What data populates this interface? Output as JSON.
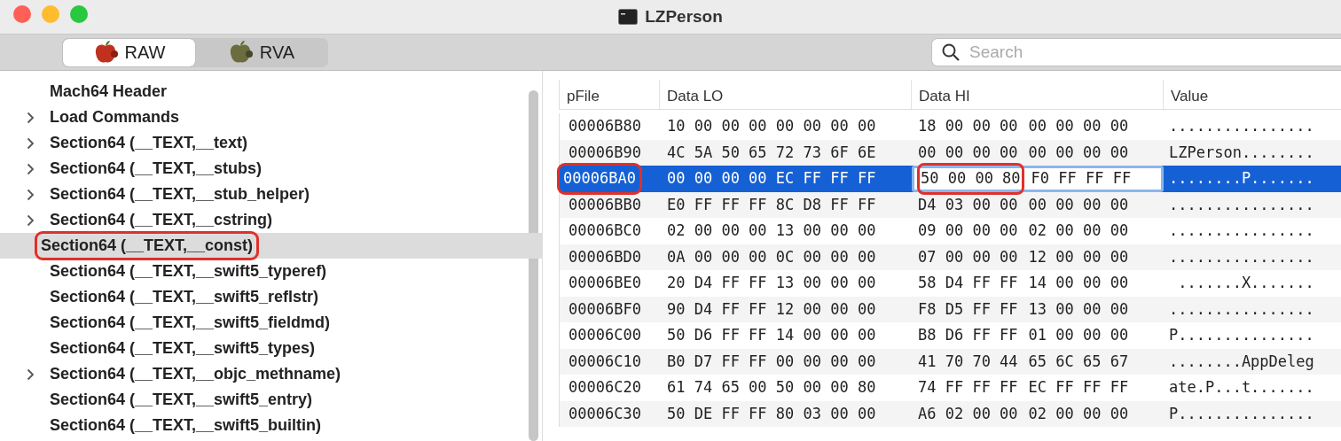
{
  "window": {
    "title": "LZPerson"
  },
  "modes": [
    {
      "label": "RAW",
      "selected": true,
      "kind": "raw"
    },
    {
      "label": "RVA",
      "selected": false,
      "kind": "rva"
    }
  ],
  "search": {
    "placeholder": "Search"
  },
  "tree": [
    {
      "label": "Mach64 Header",
      "expandable": false,
      "selected": false,
      "circled": false
    },
    {
      "label": "Load Commands",
      "expandable": true,
      "selected": false,
      "circled": false
    },
    {
      "label": "Section64 (__TEXT,__text)",
      "expandable": true,
      "selected": false,
      "circled": false
    },
    {
      "label": "Section64 (__TEXT,__stubs)",
      "expandable": true,
      "selected": false,
      "circled": false
    },
    {
      "label": "Section64 (__TEXT,__stub_helper)",
      "expandable": true,
      "selected": false,
      "circled": false
    },
    {
      "label": "Section64 (__TEXT,__cstring)",
      "expandable": true,
      "selected": false,
      "circled": false
    },
    {
      "label": "Section64 (__TEXT,__const)",
      "expandable": false,
      "selected": true,
      "circled": true
    },
    {
      "label": "Section64 (__TEXT,__swift5_typeref)",
      "expandable": false,
      "selected": false,
      "circled": false
    },
    {
      "label": "Section64 (__TEXT,__swift5_reflstr)",
      "expandable": false,
      "selected": false,
      "circled": false
    },
    {
      "label": "Section64 (__TEXT,__swift5_fieldmd)",
      "expandable": false,
      "selected": false,
      "circled": false
    },
    {
      "label": "Section64 (__TEXT,__swift5_types)",
      "expandable": false,
      "selected": false,
      "circled": false
    },
    {
      "label": "Section64 (__TEXT,__objc_methname)",
      "expandable": true,
      "selected": false,
      "circled": false
    },
    {
      "label": "Section64 (__TEXT,__swift5_entry)",
      "expandable": false,
      "selected": false,
      "circled": false
    },
    {
      "label": "Section64 (__TEXT,__swift5_builtin)",
      "expandable": false,
      "selected": false,
      "circled": false
    }
  ],
  "table": {
    "columns": [
      "pFile",
      "Data LO",
      "Data HI",
      "Value"
    ],
    "rows": [
      {
        "pfile": "00006B80",
        "lo": "10 00 00 00 00 00 00 00",
        "hi": [
          "18 00 00 00",
          "00 00 00 00"
        ],
        "value": "................",
        "selected": false,
        "pfile_circled": false,
        "hi_circled": false,
        "editing": false
      },
      {
        "pfile": "00006B90",
        "lo": "4C 5A 50 65 72 73 6F 6E",
        "hi": [
          "00 00 00 00",
          "00 00 00 00"
        ],
        "value": "LZPerson........",
        "selected": false,
        "pfile_circled": false,
        "hi_circled": false,
        "editing": false
      },
      {
        "pfile": "00006BA0",
        "lo": "00 00 00 00 EC FF FF FF",
        "hi": [
          "50 00 00 80",
          "F0 FF FF FF"
        ],
        "value": "........P.......",
        "selected": true,
        "pfile_circled": true,
        "hi_circled": true,
        "editing": true
      },
      {
        "pfile": "00006BB0",
        "lo": "E0 FF FF FF 8C D8 FF FF",
        "hi": [
          "D4 03 00 00",
          "00 00 00 00"
        ],
        "value": "................",
        "selected": false,
        "pfile_circled": false,
        "hi_circled": false,
        "editing": false
      },
      {
        "pfile": "00006BC0",
        "lo": "02 00 00 00 13 00 00 00",
        "hi": [
          "09 00 00 00",
          "02 00 00 00"
        ],
        "value": "................",
        "selected": false,
        "pfile_circled": false,
        "hi_circled": false,
        "editing": false
      },
      {
        "pfile": "00006BD0",
        "lo": "0A 00 00 00 0C 00 00 00",
        "hi": [
          "07 00 00 00",
          "12 00 00 00"
        ],
        "value": "................",
        "selected": false,
        "pfile_circled": false,
        "hi_circled": false,
        "editing": false
      },
      {
        "pfile": "00006BE0",
        "lo": "20 D4 FF FF 13 00 00 00",
        "hi": [
          "58 D4 FF FF",
          "14 00 00 00"
        ],
        "value": " .......X.......",
        "selected": false,
        "pfile_circled": false,
        "hi_circled": false,
        "editing": false
      },
      {
        "pfile": "00006BF0",
        "lo": "90 D4 FF FF 12 00 00 00",
        "hi": [
          "F8 D5 FF FF",
          "13 00 00 00"
        ],
        "value": "................",
        "selected": false,
        "pfile_circled": false,
        "hi_circled": false,
        "editing": false
      },
      {
        "pfile": "00006C00",
        "lo": "50 D6 FF FF 14 00 00 00",
        "hi": [
          "B8 D6 FF FF",
          "01 00 00 00"
        ],
        "value": "P...............",
        "selected": false,
        "pfile_circled": false,
        "hi_circled": false,
        "editing": false
      },
      {
        "pfile": "00006C10",
        "lo": "B0 D7 FF FF 00 00 00 00",
        "hi": [
          "41 70 70 44",
          "65 6C 65 67"
        ],
        "value": "........AppDeleg",
        "selected": false,
        "pfile_circled": false,
        "hi_circled": false,
        "editing": false
      },
      {
        "pfile": "00006C20",
        "lo": "61 74 65 00 50 00 00 80",
        "hi": [
          "74 FF FF FF",
          "EC FF FF FF"
        ],
        "value": "ate.P...t.......",
        "selected": false,
        "pfile_circled": false,
        "hi_circled": false,
        "editing": false
      },
      {
        "pfile": "00006C30",
        "lo": "50 DE FF FF 80 03 00 00",
        "hi": [
          "A6 02 00 00",
          "02 00 00 00"
        ],
        "value": "P...............",
        "selected": false,
        "pfile_circled": false,
        "hi_circled": false,
        "editing": false
      }
    ]
  }
}
